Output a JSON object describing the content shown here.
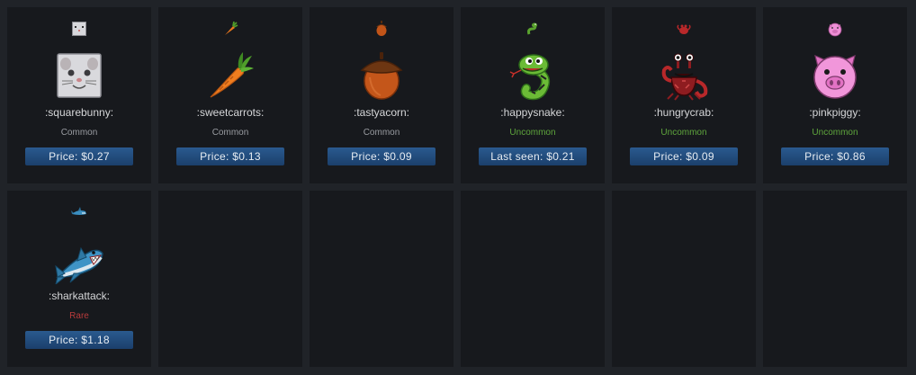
{
  "items": [
    {
      "name": ":squarebunny:",
      "rarity": "Common",
      "price": "Price: $0.27",
      "icon": "square-bunny"
    },
    {
      "name": ":sweetcarrots:",
      "rarity": "Common",
      "price": "Price: $0.13",
      "icon": "carrot"
    },
    {
      "name": ":tastyacorn:",
      "rarity": "Common",
      "price": "Price: $0.09",
      "icon": "acorn"
    },
    {
      "name": ":happysnake:",
      "rarity": "Uncommon",
      "price": "Last seen: $0.21",
      "icon": "snake"
    },
    {
      "name": ":hungrycrab:",
      "rarity": "Uncommon",
      "price": "Price: $0.09",
      "icon": "crab"
    },
    {
      "name": ":pinkpiggy:",
      "rarity": "Uncommon",
      "price": "Price: $0.86",
      "icon": "pig"
    },
    {
      "name": ":sharkattack:",
      "rarity": "Rare",
      "price": "Price: $1.18",
      "icon": "shark"
    }
  ],
  "colors": {
    "common": "#9a9da2",
    "uncommon": "#5fa63d",
    "rare": "#b83b3b",
    "price_button": "#1b3f6b"
  }
}
